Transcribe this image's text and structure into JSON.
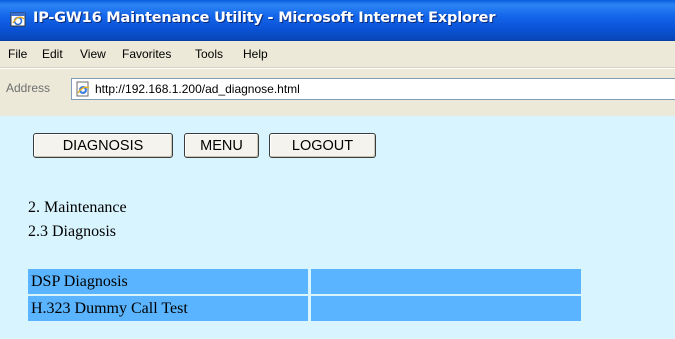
{
  "window": {
    "title": "IP-GW16 Maintenance Utility - Microsoft Internet Explorer"
  },
  "menubar": {
    "items": [
      "File",
      "Edit",
      "View",
      "Favorites",
      "Tools",
      "Help"
    ]
  },
  "address": {
    "label": "Address",
    "url": "http://192.168.1.200/ad_diagnose.html"
  },
  "page": {
    "buttons": {
      "diagnosis": "DIAGNOSIS",
      "menu": "MENU",
      "logout": "LOGOUT"
    },
    "headings": [
      "2. Maintenance",
      "2.3 Diagnosis"
    ],
    "diagnosis_table": {
      "rows": [
        {
          "label": "DSP Diagnosis",
          "value": ""
        },
        {
          "label": "H.323 Dummy Call Test",
          "value": ""
        }
      ]
    }
  },
  "colors": {
    "titlebar": "#0a5fdc",
    "chrome": "#ece9d8",
    "page_background": "#d8f5ff",
    "table_cell": "#5ab4ff"
  },
  "icons": {
    "titlebar": "ie-window-icon",
    "address": "ie-page-icon"
  }
}
